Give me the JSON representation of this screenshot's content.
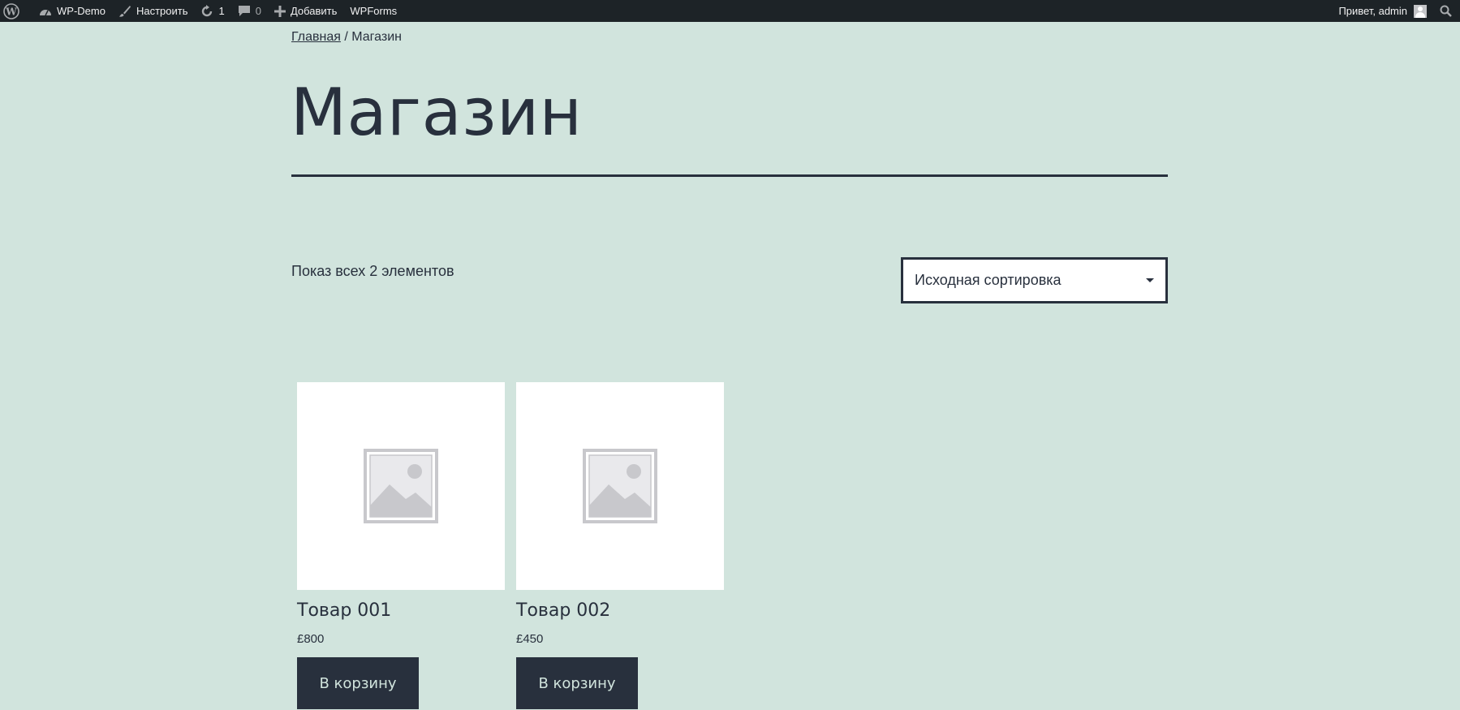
{
  "adminbar": {
    "site_name": "WP-Demo",
    "customize": "Настроить",
    "updates_count": "1",
    "comments_count": "0",
    "add_new": "Добавить",
    "wpforms": "WPForms",
    "greeting": "Привет, admin",
    "icons": [
      "wordpress-icon",
      "dashboard-icon",
      "brush-icon",
      "updates-icon",
      "comments-icon",
      "plus-icon",
      "avatar",
      "search-icon"
    ]
  },
  "breadcrumb": {
    "home": "Главная",
    "separator": " / ",
    "current": "Магазин"
  },
  "page": {
    "title": "Магазин",
    "result_count": "Показ всех 2 элементов",
    "sort_selected": "Исходная сортировка"
  },
  "products": [
    {
      "title": "Товар 001",
      "price": "£800",
      "button": "В корзину"
    },
    {
      "title": "Товар 002",
      "price": "£450",
      "button": "В корзину"
    }
  ],
  "colors": {
    "background": "#d1e4dd",
    "text": "#28303d",
    "adminbar": "#1d2327"
  }
}
